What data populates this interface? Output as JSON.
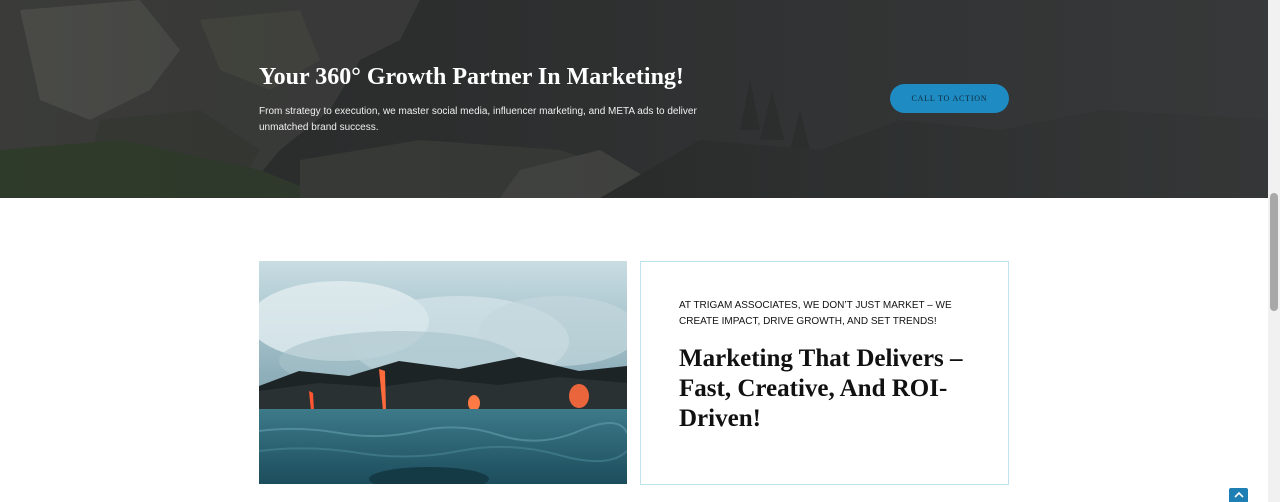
{
  "hero": {
    "title": "Your 360° Growth Partner In Marketing!",
    "subtitle": "From strategy to execution, we master social media, influencer marketing, and META ads to deliver unmatched brand success.",
    "cta_label": "CALL TO ACTION"
  },
  "feature": {
    "eyebrow": "AT TRIGAM ASSOCIATES, WE DON’T JUST MARKET – WE CREATE IMPACT, DRIVE GROWTH, AND SET TRENDS!",
    "title": "Marketing That Delivers – Fast, Creative, And ROI-Driven!"
  },
  "colors": {
    "accent": "#1e8bc3",
    "card_border": "#bfe3ee",
    "hero_bg": "#2a2c2c"
  },
  "icons": {
    "back_to_top": "chevron-up-icon"
  }
}
